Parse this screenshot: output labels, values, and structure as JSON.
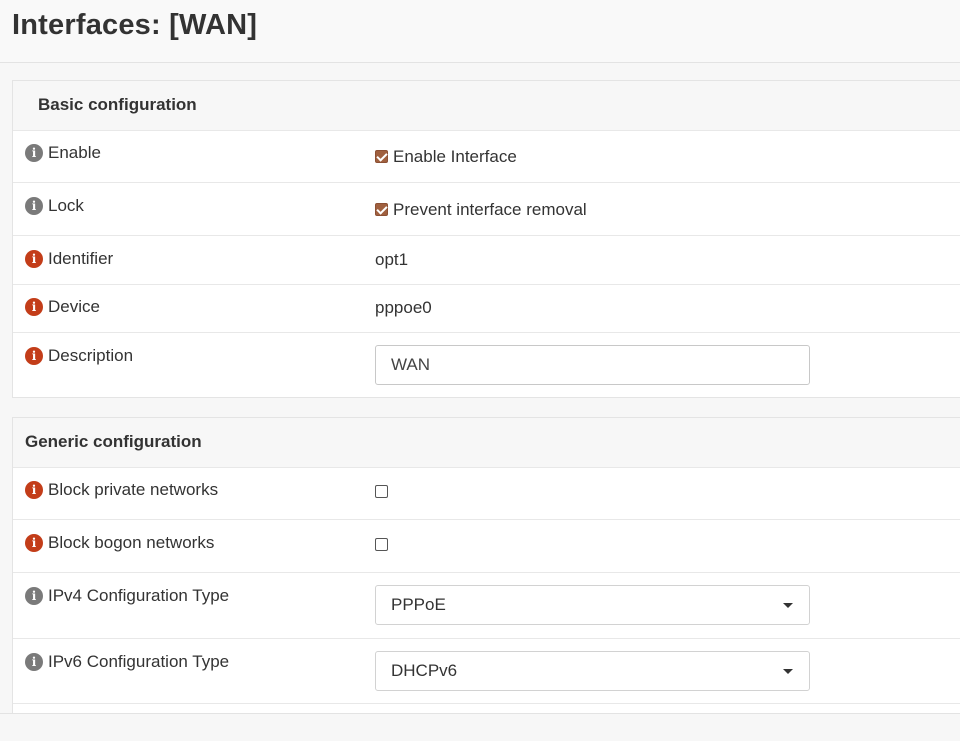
{
  "page": {
    "title": "Interfaces: [WAN]"
  },
  "basic": {
    "section_title": "Basic configuration",
    "enable": {
      "label": "Enable",
      "checkbox_label": "Enable Interface",
      "checked": true
    },
    "lock": {
      "label": "Lock",
      "checkbox_label": "Prevent interface removal",
      "checked": true
    },
    "identifier": {
      "label": "Identifier",
      "value": "opt1"
    },
    "device": {
      "label": "Device",
      "value": "pppoe0"
    },
    "description": {
      "label": "Description",
      "value": "WAN"
    }
  },
  "generic": {
    "section_title": "Generic configuration",
    "block_private": {
      "label": "Block private networks",
      "checked": false
    },
    "block_bogon": {
      "label": "Block bogon networks",
      "checked": false
    },
    "ipv4_type": {
      "label": "IPv4 Configuration Type",
      "value": "PPPoE"
    },
    "ipv6_type": {
      "label": "IPv6 Configuration Type",
      "value": "DHCPv6"
    }
  },
  "colors": {
    "info_gray": "#7a7a7a",
    "info_red": "#c33d19",
    "checkbox_checked": "#a0603f"
  },
  "icons": {
    "info": "info-circle-icon",
    "dropdown": "caret-down-icon"
  }
}
